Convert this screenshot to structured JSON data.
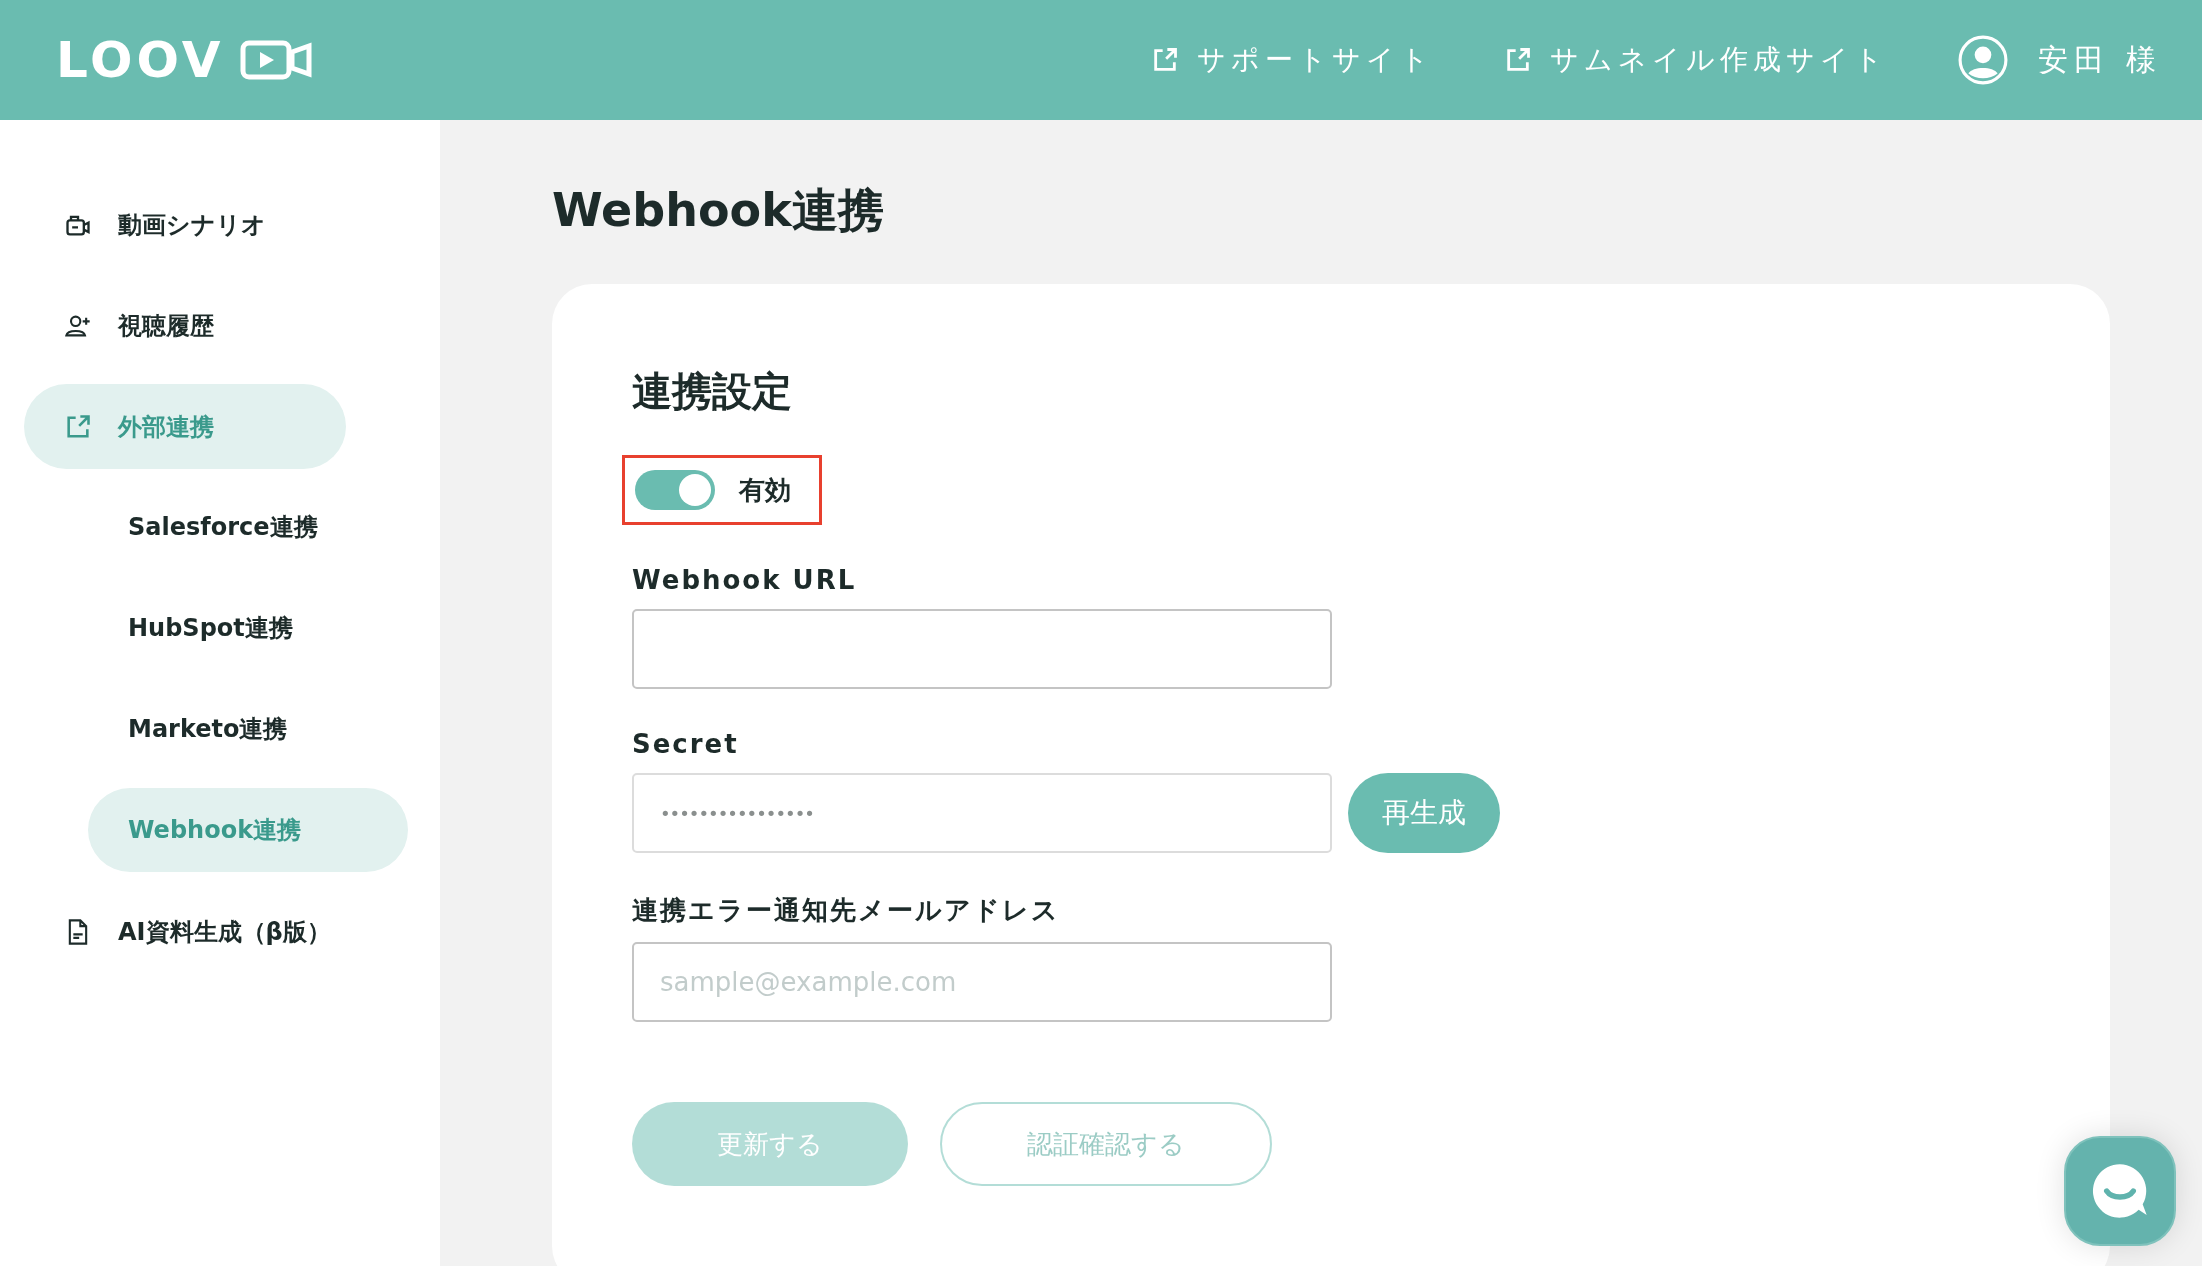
{
  "header": {
    "logo": "LOOV",
    "links": [
      {
        "label": "サポートサイト"
      },
      {
        "label": "サムネイル作成サイト"
      }
    ],
    "user": "安田 様"
  },
  "sidebar": {
    "items": [
      {
        "label": "動画シナリオ",
        "kind": "video",
        "selected": false
      },
      {
        "label": "視聴履歴",
        "kind": "user",
        "selected": false
      },
      {
        "label": "外部連携",
        "kind": "external",
        "selected": true,
        "children": [
          {
            "label": "Salesforce連携",
            "selected": false
          },
          {
            "label": "HubSpot連携",
            "selected": false
          },
          {
            "label": "Marketo連携",
            "selected": false
          },
          {
            "label": "Webhook連携",
            "selected": true
          }
        ]
      },
      {
        "label": "AI資料生成（β版）",
        "kind": "document",
        "selected": false
      }
    ]
  },
  "page_title": "Webhook連携",
  "card": {
    "heading": "連携設定",
    "toggle": {
      "label": "有効",
      "on": true,
      "highlighted": true
    },
    "fields": [
      {
        "label": "Webhook URL",
        "kind": "text"
      },
      {
        "label": "Secret",
        "kind": "secret",
        "value": "••••••••••••••••",
        "button": "再生成"
      },
      {
        "label": "連携エラー通知先メールアドレス",
        "kind": "text",
        "placeholder": "sample@example.com"
      }
    ],
    "buttons": [
      {
        "label": "更新する",
        "kind": "primary",
        "disabled": true
      },
      {
        "label": "認証確認する",
        "kind": "outline",
        "disabled": true
      }
    ]
  }
}
